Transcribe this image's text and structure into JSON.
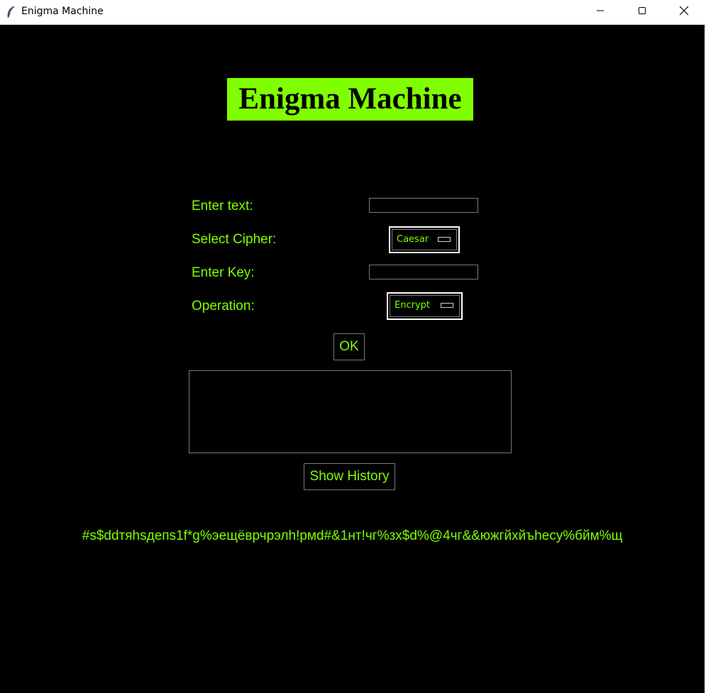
{
  "window": {
    "title": "Enigma Machine",
    "icons": [
      "feather-icon",
      "minimize-icon",
      "maximize-icon",
      "close-icon"
    ]
  },
  "app": {
    "heading": "Enigma Machine"
  },
  "form": {
    "text_label": "Enter text:",
    "text_value": "",
    "cipher_label": "Select Cipher:",
    "cipher_selected": "Caesar",
    "key_label": "Enter Key:",
    "key_value": "",
    "operation_label": "Operation:",
    "operation_selected": "Encrypt",
    "ok_label": "OK"
  },
  "output": {
    "content": "",
    "history_label": "Show History",
    "result": "#s$ddтяhsдепs1f*g%эещёврчрэлh!рмd#&1нт!чг%зх$d%@4чг&&южгйхйъhесу%бйм%щ"
  },
  "colors": {
    "accent": "#80ff00",
    "background": "#000000",
    "titlebar": "#ffffff"
  }
}
